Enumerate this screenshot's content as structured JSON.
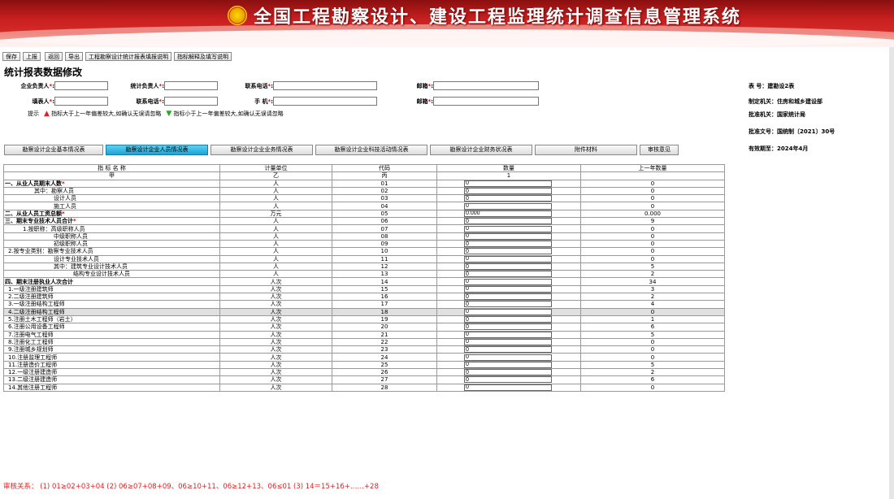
{
  "banner": {
    "title": "全国工程勘察设计、建设工程监理统计调查信息管理系统"
  },
  "toolbar": {
    "save": "保存",
    "submit": "上报",
    "back": "返回",
    "export": "导出",
    "guide": "工程勘察设计统计报表填报说明",
    "indicator": "指标解释及填写说明"
  },
  "page_title": "统计报表数据修改",
  "form": {
    "row1": [
      {
        "label": "企业负责人",
        "required": "*",
        "value": ""
      },
      {
        "label": "统计负责人",
        "required": "*",
        "value": ""
      },
      {
        "label": "联系电话",
        "required": "*",
        "value": ""
      },
      {
        "label": "邮箱",
        "required": "*",
        "value": ""
      }
    ],
    "row2": [
      {
        "label": "填表人",
        "required": "*",
        "value": ""
      },
      {
        "label": "联系电话",
        "required": "*",
        "value": ""
      },
      {
        "label": "手 机",
        "required": "*",
        "value": ""
      },
      {
        "label": "邮箱",
        "required": "*",
        "value": ""
      }
    ],
    "hint_label": "提示",
    "hint_up": "指标大于上一年偏差较大,如确认无误请忽略",
    "hint_down": "指标小于上一年偏差较大,如确认无误请忽略"
  },
  "meta": {
    "table_no": "表 号：建勘设2表",
    "authority": "制定机关：住房和城乡建设部",
    "approver": "批准机关：国家统计局",
    "approval_no": "批准文号：国统制〔2021〕30号",
    "valid": "有效期至：2024年4月"
  },
  "tabs": [
    "勘察设计企业基本情况表",
    "勘察设计企业人员情况表",
    "勘察设计企业业务情况表",
    "勘察设计企业科技活动情况表",
    "勘察设计企业财务状况表",
    "附件材料",
    "审核意见"
  ],
  "table": {
    "headers": [
      "指 标 名 称",
      "计量单位",
      "代码",
      "数量",
      "上一年数量"
    ],
    "subheaders": [
      "甲",
      "乙",
      "丙",
      "1",
      ""
    ],
    "rows": [
      {
        "name": "一、从业人员期末人数",
        "req": "*",
        "unit": "人",
        "code": "01",
        "value": "0",
        "prev": "0",
        "bold": true
      },
      {
        "name": "其中：勘察人员",
        "unit": "人",
        "code": "02",
        "value": "0",
        "prev": "0"
      },
      {
        "name": "设计人员",
        "unit": "人",
        "code": "03",
        "value": "0",
        "prev": "0"
      },
      {
        "name": "施工人员",
        "unit": "人",
        "code": "04",
        "value": "0",
        "prev": "0"
      },
      {
        "name": "二、从业人员工资总额",
        "req": "*",
        "unit": "万元",
        "code": "05",
        "value": "0.000",
        "prev": "0.000",
        "bold": true
      },
      {
        "name": "三、期末专业技术人员合计",
        "req": "*",
        "unit": "人",
        "code": "06",
        "value": "0",
        "prev": "9",
        "bold": true
      },
      {
        "name": "1.按职称：高级职称人员",
        "unit": "人",
        "code": "07",
        "value": "0",
        "prev": "0"
      },
      {
        "name": "中级职称人员",
        "unit": "人",
        "code": "08",
        "value": "0",
        "prev": "0"
      },
      {
        "name": "初级职称人员",
        "unit": "人",
        "code": "09",
        "value": "0",
        "prev": "0"
      },
      {
        "name": "2.按专业类别：勘察专业技术人员",
        "unit": "人",
        "code": "10",
        "value": "0",
        "prev": "0"
      },
      {
        "name": "设计专业技术人员",
        "unit": "人",
        "code": "11",
        "value": "0",
        "prev": "0"
      },
      {
        "name": "其中：建筑专业设计技术人员",
        "unit": "人",
        "code": "12",
        "value": "0",
        "prev": "5"
      },
      {
        "name": "结构专业设计技术人员",
        "unit": "人",
        "code": "13",
        "value": "0",
        "prev": "2"
      },
      {
        "name": "四、期末注册执业人次合计",
        "unit": "人次",
        "code": "14",
        "value": "0",
        "prev": "34",
        "bold": true
      },
      {
        "name": "1.一级注册建筑师",
        "unit": "人次",
        "code": "15",
        "value": "0",
        "prev": "3"
      },
      {
        "name": "2.二级注册建筑师",
        "unit": "人次",
        "code": "16",
        "value": "0",
        "prev": "2"
      },
      {
        "name": "3.一级注册结构工程师",
        "unit": "人次",
        "code": "17",
        "value": "0",
        "prev": "4"
      },
      {
        "name": "4.二级注册结构工程师",
        "unit": "人次",
        "code": "18",
        "value": "0",
        "prev": "0",
        "hl": true
      },
      {
        "name": "5.注册土木工程师（岩土）",
        "unit": "人次",
        "code": "19",
        "value": "0",
        "prev": "1"
      },
      {
        "name": "6.注册公用设备工程师",
        "unit": "人次",
        "code": "20",
        "value": "0",
        "prev": "6"
      },
      {
        "name": "7.注册电气工程师",
        "unit": "人次",
        "code": "21",
        "value": "0",
        "prev": "5"
      },
      {
        "name": "8.注册化工工程师",
        "unit": "人次",
        "code": "22",
        "value": "0",
        "prev": "0"
      },
      {
        "name": "9.注册城乡规划师",
        "unit": "人次",
        "code": "23",
        "value": "0",
        "prev": "0"
      },
      {
        "name": "10.注册监理工程师",
        "unit": "人次",
        "code": "24",
        "value": "0",
        "prev": "0"
      },
      {
        "name": "11.注册造价工程师",
        "unit": "人次",
        "code": "25",
        "value": "0",
        "prev": "5"
      },
      {
        "name": "12.一级注册建造师",
        "unit": "人次",
        "code": "26",
        "value": "0",
        "prev": "2"
      },
      {
        "name": "13.二级注册建造师",
        "unit": "人次",
        "code": "27",
        "value": "0",
        "prev": "6"
      },
      {
        "name": "14.其他注册工程师",
        "unit": "人次",
        "code": "28",
        "value": "0",
        "prev": "0"
      }
    ]
  },
  "audit": "审核关系： (1) 01≥02+03+04  (2) 06≥07+08+09、06≥10+11、06≥12+13、06≤01  (3) 14＝15+16+……+28"
}
